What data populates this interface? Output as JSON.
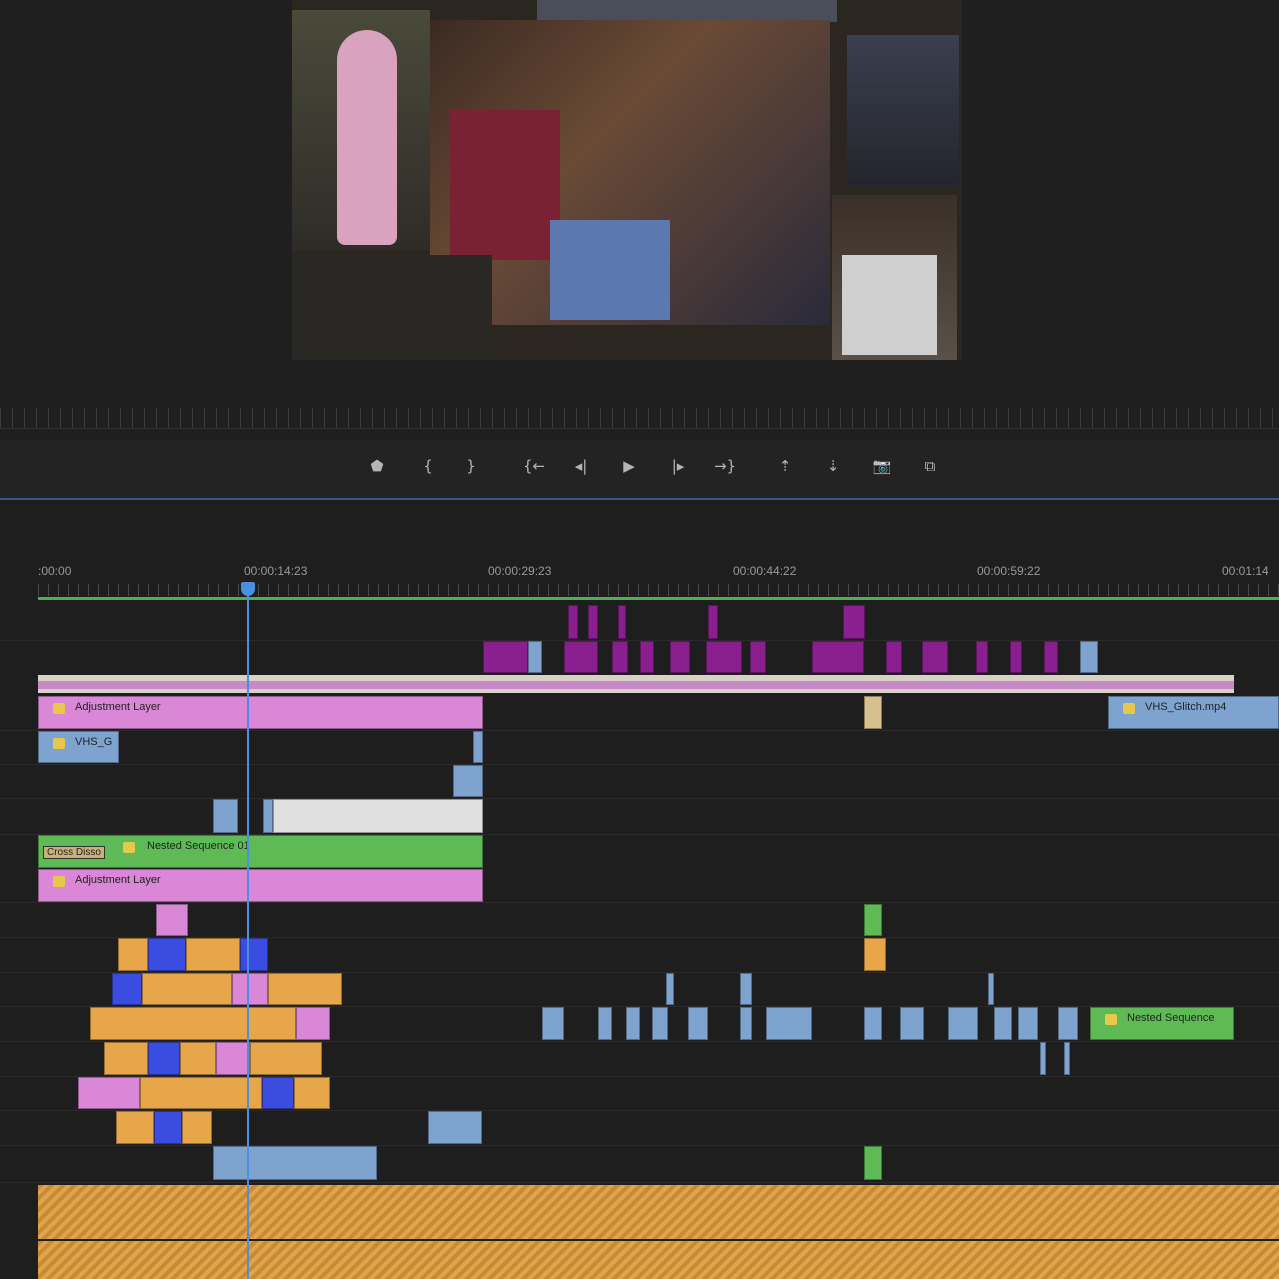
{
  "controls": [
    {
      "name": "add-marker-button",
      "glyph": "⬟"
    },
    {
      "name": "mark-in-button",
      "glyph": "{"
    },
    {
      "name": "mark-out-button",
      "glyph": "}"
    },
    {
      "name": "go-to-in-button",
      "glyph": "{←"
    },
    {
      "name": "step-back-button",
      "glyph": "◂|"
    },
    {
      "name": "play-button",
      "glyph": "▶"
    },
    {
      "name": "step-forward-button",
      "glyph": "|▸"
    },
    {
      "name": "go-to-out-button",
      "glyph": "→}"
    },
    {
      "name": "lift-button",
      "glyph": "⇡"
    },
    {
      "name": "extract-button",
      "glyph": "⇣"
    },
    {
      "name": "export-frame-button",
      "glyph": "📷"
    },
    {
      "name": "compare-view-button",
      "glyph": "⧉"
    }
  ],
  "timeline": {
    "timecodes": [
      ":00:00",
      "00:00:14:23",
      "00:00:29:23",
      "00:00:44:22",
      "00:00:59:22",
      "00:01:14"
    ],
    "clips": {
      "adjustment_layer_top": "Adjustment Layer",
      "vhs_short": "VHS_G",
      "vhs_glitch": "VHS_Glitch.mp4",
      "cross_dissolve": "Cross Disso",
      "nested_sequence_01": "Nested Sequence 01",
      "adjustment_layer_mid": "Adjustment Layer",
      "nested_sequence": "Nested Sequence"
    }
  },
  "colors": {
    "adjustment": "#d987d6",
    "nested": "#5dba55",
    "video": "#7fa3cf",
    "audio": "#e0a54c",
    "playhead": "#4a8fe0"
  }
}
